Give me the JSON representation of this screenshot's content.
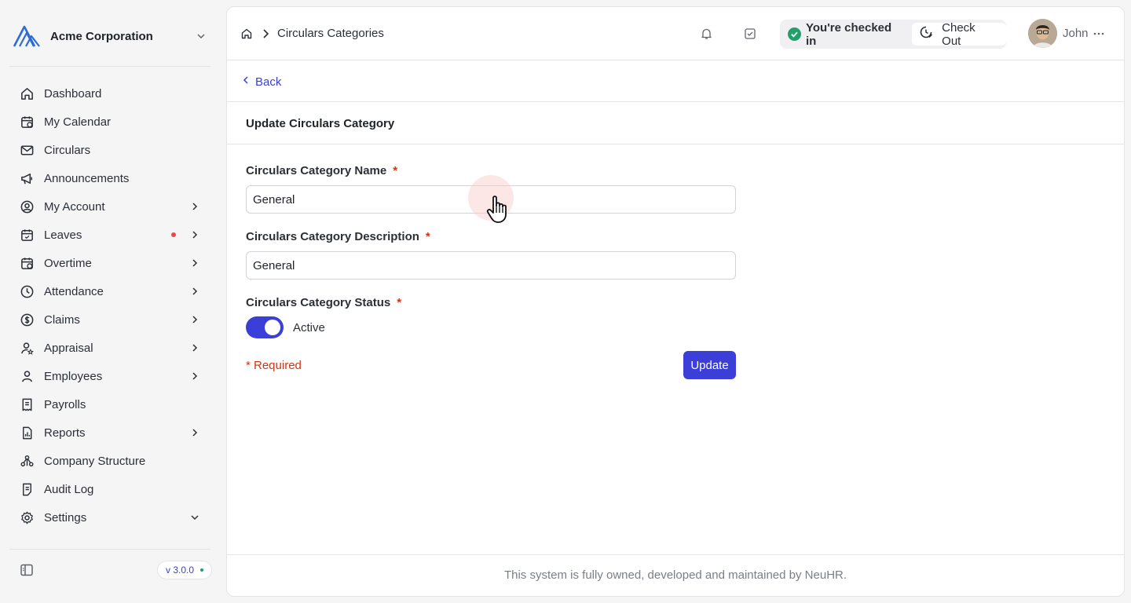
{
  "brand": {
    "name": "Acme Corporation"
  },
  "sidebar": {
    "items": [
      {
        "label": "Dashboard",
        "icon": "home-icon",
        "chevron": false,
        "dot": false
      },
      {
        "label": "My Calendar",
        "icon": "calendar-icon",
        "chevron": false,
        "dot": false
      },
      {
        "label": "Circulars",
        "icon": "mail-icon",
        "chevron": false,
        "dot": false
      },
      {
        "label": "Announcements",
        "icon": "megaphone-icon",
        "chevron": false,
        "dot": false
      },
      {
        "label": "My Account",
        "icon": "user-circle-icon",
        "chevron": true,
        "dot": false
      },
      {
        "label": "Leaves",
        "icon": "calendar-check-icon",
        "chevron": true,
        "dot": true
      },
      {
        "label": "Overtime",
        "icon": "calendar-clock-icon",
        "chevron": true,
        "dot": false
      },
      {
        "label": "Attendance",
        "icon": "clock-icon",
        "chevron": true,
        "dot": false
      },
      {
        "label": "Claims",
        "icon": "dollar-circle-icon",
        "chevron": true,
        "dot": false
      },
      {
        "label": "Appraisal",
        "icon": "user-star-icon",
        "chevron": true,
        "dot": false
      },
      {
        "label": "Employees",
        "icon": "user-icon",
        "chevron": true,
        "dot": false
      },
      {
        "label": "Payrolls",
        "icon": "receipt-icon",
        "chevron": false,
        "dot": false
      },
      {
        "label": "Reports",
        "icon": "file-chart-icon",
        "chevron": true,
        "dot": false
      },
      {
        "label": "Company Structure",
        "icon": "hierarchy-icon",
        "chevron": false,
        "dot": false
      },
      {
        "label": "Audit Log",
        "icon": "clipboard-icon",
        "chevron": false,
        "dot": false
      },
      {
        "label": "Settings",
        "icon": "gear-icon",
        "chevron": "down",
        "dot": false
      }
    ],
    "version": "v 3.0.0"
  },
  "header": {
    "breadcrumb": "Circulars Categories",
    "checkin_status": "You're checked in",
    "checkout_label": "Check Out",
    "user_name": "John"
  },
  "form": {
    "back_label": "Back",
    "title": "Update Circulars Category",
    "name_label": "Circulars Category Name",
    "name_value": "General",
    "description_label": "Circulars Category Description",
    "description_value": "General",
    "status_label": "Circulars Category Status",
    "status_value": "Active",
    "required_mark": "*",
    "required_note": "* Required",
    "submit_label": "Update"
  },
  "footer": {
    "text": "This system is fully owned, developed and maintained by NeuHR."
  },
  "colors": {
    "accent": "#3b3fd8",
    "required": "#d13415",
    "success": "#22a06b"
  }
}
